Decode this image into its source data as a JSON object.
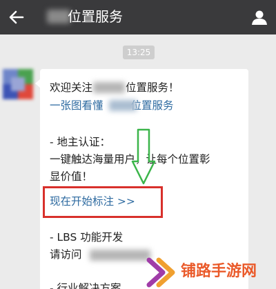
{
  "header": {
    "title": "位置服务",
    "back_icon": "back-arrow-icon",
    "user_icon": "user-profile-icon",
    "bg_color": "#3a3a3c"
  },
  "chat": {
    "timestamp": "13:25",
    "message": {
      "welcome_prefix": "欢迎关注",
      "welcome_suffix": "位置服务！",
      "link_prefix": "一张图看懂",
      "link_suffix": "位置服务",
      "section1_title": "- 地主认证：",
      "section1_line1": "一键触达海量用户，让每个位置彰",
      "section1_line2": "显价值！",
      "action_link": "现在开始标注 >>",
      "section2_title": "- LBS 功能开发",
      "section2_line1": "请访问",
      "section3_partial": "- 行业解决方案"
    }
  },
  "watermark": {
    "text": "铺路手游网",
    "icon": "brand-logo-icon",
    "color": "#ea5a2a"
  },
  "colors": {
    "link": "#2d6aa0",
    "highlight_box": "#d8302b",
    "annotation_arrow": "#3bb54a"
  }
}
